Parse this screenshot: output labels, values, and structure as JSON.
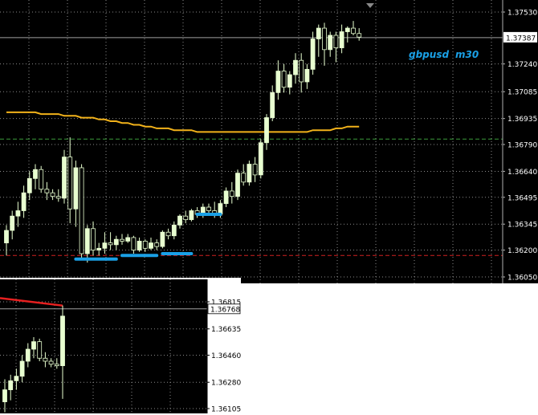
{
  "main_chart": {
    "symbol_label": "gbpusd",
    "timeframe_label": "m30",
    "price_labels": [
      "1.37530",
      "1.37387",
      "1.37240",
      "1.37085",
      "1.36935",
      "1.36790",
      "1.36640",
      "1.36495",
      "1.36345",
      "1.36200",
      "1.36050"
    ],
    "current_price": "1.37387",
    "colors": {
      "background": "#000000",
      "grid": "#8a8a8a",
      "candle_up": "#e8ffd0",
      "candle_down": "#e8ffd0",
      "ma_line": "#f2b21a",
      "level_marks": "#1aa0e6",
      "resistance_line": "#d02020",
      "support_line": "#3a9a3a",
      "label_text": "#1aa0e6"
    }
  },
  "sub_chart": {
    "price_labels": [
      "1.36815",
      "1.36635",
      "1.36460",
      "1.36280",
      "1.36105"
    ],
    "current_price": "1.36768",
    "colors": {
      "background": "#000000",
      "grid": "#8a8a8a",
      "trend_line": "#e82020"
    }
  },
  "chart_data": [
    {
      "type": "candlestick",
      "title": "gbpusd m30",
      "ylim": [
        1.36,
        1.376
      ],
      "y_ticks": [
        1.3753,
        1.37387,
        1.3724,
        1.37085,
        1.36935,
        1.3679,
        1.3664,
        1.36495,
        1.36345,
        1.362,
        1.3605
      ],
      "candles": [
        [
          1.3624,
          1.3634,
          1.3617,
          1.3631
        ],
        [
          1.3631,
          1.3642,
          1.3626,
          1.3639
        ],
        [
          1.3639,
          1.3647,
          1.3633,
          1.3642
        ],
        [
          1.3642,
          1.3656,
          1.3638,
          1.3652
        ],
        [
          1.3652,
          1.3664,
          1.3648,
          1.366
        ],
        [
          1.366,
          1.3668,
          1.3654,
          1.3665
        ],
        [
          1.3665,
          1.3667,
          1.3652,
          1.3654
        ],
        [
          1.3654,
          1.3658,
          1.3648,
          1.3652
        ],
        [
          1.3652,
          1.3654,
          1.3648,
          1.365
        ],
        [
          1.365,
          1.3654,
          1.3647,
          1.3649
        ],
        [
          1.3649,
          1.3676,
          1.3646,
          1.3672
        ],
        [
          1.3672,
          1.3683,
          1.3635,
          1.3643
        ],
        [
          1.3643,
          1.367,
          1.3633,
          1.3666
        ],
        [
          1.3666,
          1.3668,
          1.3615,
          1.3618
        ],
        [
          1.3618,
          1.3634,
          1.3613,
          1.3632
        ],
        [
          1.3632,
          1.3636,
          1.3617,
          1.362
        ],
        [
          1.362,
          1.3624,
          1.3617,
          1.3621
        ],
        [
          1.3621,
          1.363,
          1.3618,
          1.3624
        ],
        [
          1.3624,
          1.363,
          1.362,
          1.3623
        ],
        [
          1.3623,
          1.3628,
          1.362,
          1.3626
        ],
        [
          1.3626,
          1.3629,
          1.3623,
          1.3625
        ],
        [
          1.3625,
          1.3629,
          1.3624,
          1.3627
        ],
        [
          1.3627,
          1.3628,
          1.3618,
          1.362
        ],
        [
          1.362,
          1.3627,
          1.3619,
          1.3625
        ],
        [
          1.3625,
          1.3626,
          1.3619,
          1.3621
        ],
        [
          1.3621,
          1.3627,
          1.362,
          1.3624
        ],
        [
          1.3624,
          1.3626,
          1.362,
          1.3622
        ],
        [
          1.3622,
          1.3631,
          1.3621,
          1.363
        ],
        [
          1.363,
          1.3632,
          1.3626,
          1.3628
        ],
        [
          1.3628,
          1.3636,
          1.3626,
          1.3634
        ],
        [
          1.3634,
          1.364,
          1.3632,
          1.3639
        ],
        [
          1.3639,
          1.3642,
          1.3635,
          1.3637
        ],
        [
          1.3637,
          1.3643,
          1.3636,
          1.3642
        ],
        [
          1.3642,
          1.3644,
          1.3638,
          1.364
        ],
        [
          1.364,
          1.3646,
          1.3638,
          1.3644
        ],
        [
          1.3644,
          1.3646,
          1.364,
          1.3642
        ],
        [
          1.3642,
          1.3647,
          1.3638,
          1.364
        ],
        [
          1.364,
          1.3648,
          1.3638,
          1.3646
        ],
        [
          1.3646,
          1.3655,
          1.3644,
          1.3653
        ],
        [
          1.3653,
          1.3658,
          1.3646,
          1.365
        ],
        [
          1.365,
          1.3665,
          1.3648,
          1.3663
        ],
        [
          1.3663,
          1.3668,
          1.3656,
          1.3658
        ],
        [
          1.3658,
          1.367,
          1.3656,
          1.3668
        ],
        [
          1.3668,
          1.3672,
          1.3658,
          1.3662
        ],
        [
          1.3662,
          1.3682,
          1.366,
          1.368
        ],
        [
          1.368,
          1.3696,
          1.3676,
          1.3694
        ],
        [
          1.3694,
          1.3712,
          1.3692,
          1.3708
        ],
        [
          1.3708,
          1.3726,
          1.3704,
          1.372
        ],
        [
          1.372,
          1.3724,
          1.3708,
          1.3711
        ],
        [
          1.3711,
          1.372,
          1.3707,
          1.3718
        ],
        [
          1.3718,
          1.373,
          1.3713,
          1.3726
        ],
        [
          1.3726,
          1.373,
          1.3708,
          1.3714
        ],
        [
          1.3714,
          1.3724,
          1.371,
          1.3721
        ],
        [
          1.3721,
          1.3742,
          1.3718,
          1.3738
        ],
        [
          1.3738,
          1.3746,
          1.3728,
          1.3744
        ],
        [
          1.3744,
          1.3747,
          1.3723,
          1.3732
        ],
        [
          1.3732,
          1.3742,
          1.3728,
          1.374
        ],
        [
          1.374,
          1.3742,
          1.3725,
          1.3733
        ],
        [
          1.3733,
          1.3746,
          1.373,
          1.3742
        ],
        [
          1.3742,
          1.3745,
          1.3736,
          1.3744
        ],
        [
          1.3744,
          1.3748,
          1.374,
          1.3741
        ],
        [
          1.3741,
          1.3744,
          1.3737,
          1.3739
        ]
      ],
      "moving_average": [
        1.3697,
        1.3697,
        1.3697,
        1.3697,
        1.3697,
        1.3697,
        1.3696,
        1.3696,
        1.3696,
        1.3696,
        1.3695,
        1.3695,
        1.3695,
        1.3694,
        1.3694,
        1.3694,
        1.3693,
        1.3693,
        1.3692,
        1.3692,
        1.3691,
        1.3691,
        1.369,
        1.369,
        1.3689,
        1.3689,
        1.3688,
        1.3688,
        1.3688,
        1.3687,
        1.3687,
        1.3687,
        1.3687,
        1.3686,
        1.3686,
        1.3686,
        1.3686,
        1.3686,
        1.3686,
        1.3686,
        1.3686,
        1.3686,
        1.3686,
        1.3686,
        1.3686,
        1.3686,
        1.3686,
        1.3686,
        1.3686,
        1.3686,
        1.3686,
        1.3686,
        1.3686,
        1.3687,
        1.3687,
        1.3687,
        1.3687,
        1.3688,
        1.3688,
        1.3689,
        1.3689,
        1.3689
      ],
      "horizontal_levels": [
        1.37387,
        1.3682,
        1.3617
      ],
      "level_marks": [
        {
          "from": 12,
          "to": 19,
          "y": 1.3615
        },
        {
          "from": 20,
          "to": 26,
          "y": 1.3617
        },
        {
          "from": 27,
          "to": 32,
          "y": 1.3618
        },
        {
          "from": 33,
          "to": 37,
          "y": 1.364
        }
      ]
    },
    {
      "type": "candlestick",
      "ylim": [
        1.3607,
        1.3688
      ],
      "y_ticks": [
        1.36815,
        1.36635,
        1.3646,
        1.3628,
        1.36105
      ],
      "candles": [
        [
          1.3615,
          1.363,
          1.3608,
          1.3623
        ],
        [
          1.3623,
          1.3633,
          1.3616,
          1.3629
        ],
        [
          1.3629,
          1.3637,
          1.3623,
          1.3632
        ],
        [
          1.3632,
          1.3646,
          1.3628,
          1.3642
        ],
        [
          1.3642,
          1.3654,
          1.3638,
          1.365
        ],
        [
          1.365,
          1.3658,
          1.3644,
          1.3655
        ],
        [
          1.3655,
          1.3657,
          1.3642,
          1.3644
        ],
        [
          1.3644,
          1.3648,
          1.3638,
          1.3642
        ],
        [
          1.3642,
          1.3644,
          1.3638,
          1.364
        ],
        [
          1.364,
          1.3644,
          1.3637,
          1.3639
        ],
        [
          1.3639,
          1.3679,
          1.3617,
          1.3672
        ]
      ],
      "trend_line": [
        [
          0,
          1.3684
        ],
        [
          10,
          1.3679
        ]
      ]
    }
  ]
}
